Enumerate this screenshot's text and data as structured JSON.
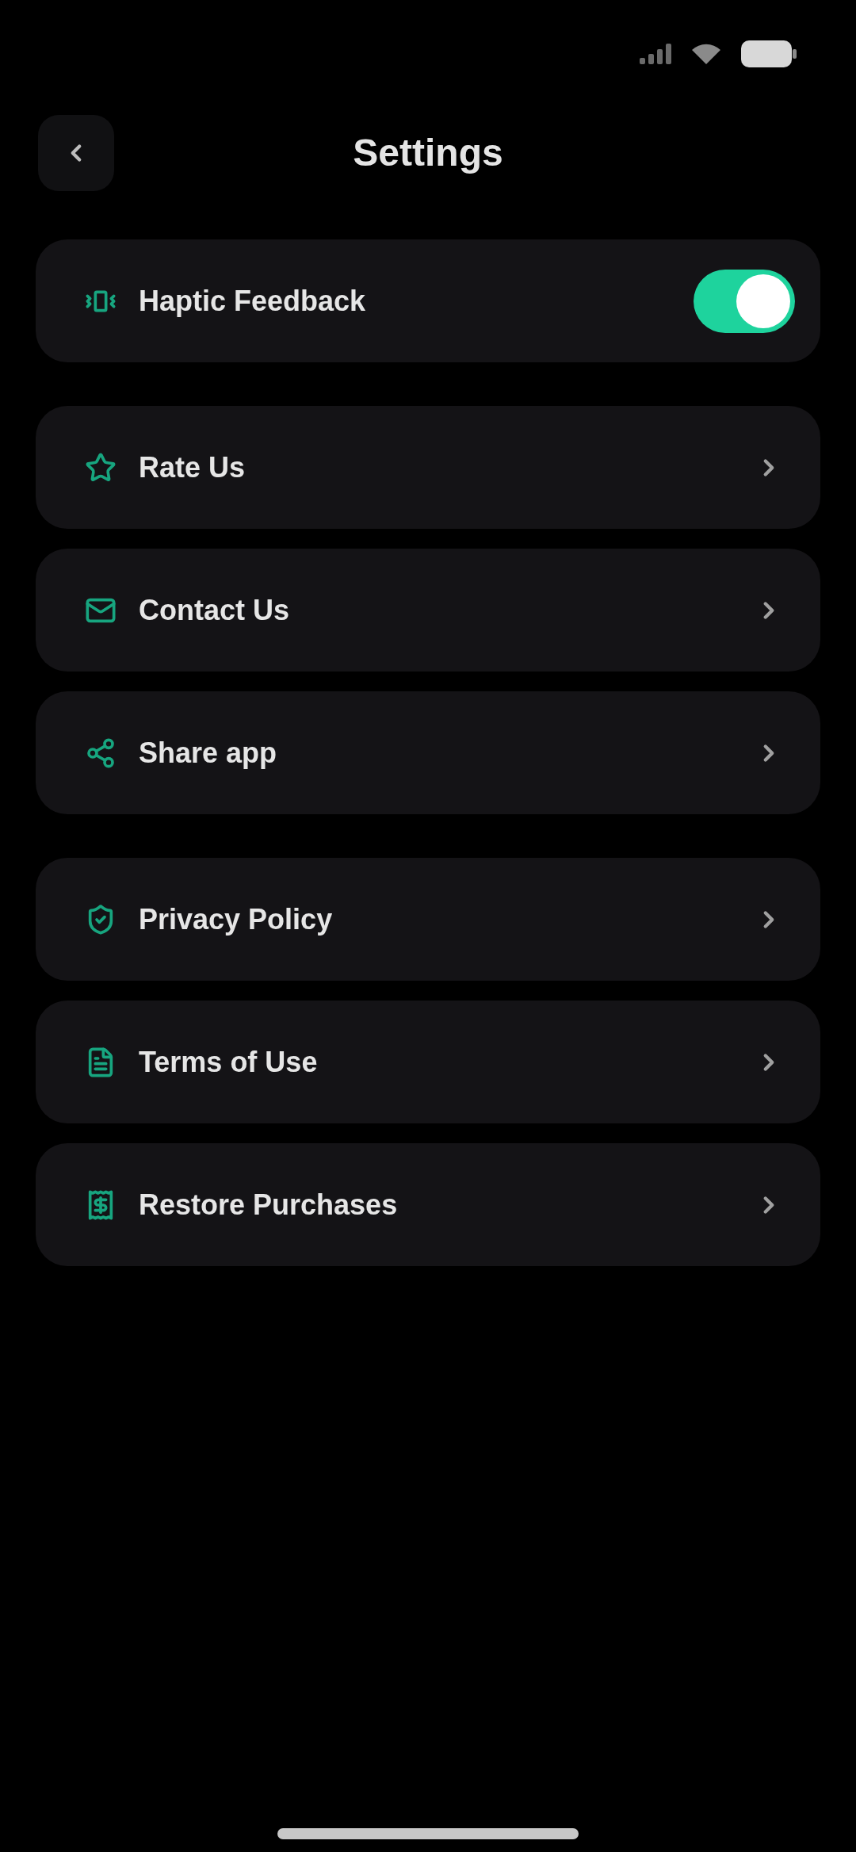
{
  "header": {
    "title": "Settings"
  },
  "groups": [
    {
      "items": [
        {
          "kind": "toggle",
          "label": "Haptic Feedback",
          "on": true
        }
      ]
    },
    {
      "items": [
        {
          "kind": "link",
          "label": "Rate Us"
        },
        {
          "kind": "link",
          "label": "Contact Us"
        },
        {
          "kind": "link",
          "label": "Share app"
        }
      ]
    },
    {
      "items": [
        {
          "kind": "link",
          "label": "Privacy Policy"
        },
        {
          "kind": "link",
          "label": "Terms of Use"
        },
        {
          "kind": "link",
          "label": "Restore Purchases"
        }
      ]
    }
  ]
}
